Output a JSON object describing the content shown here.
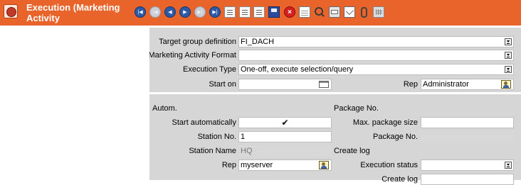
{
  "header": {
    "title": "Execution (Marketing Activity",
    "app_icon": "marketing-activity-icon",
    "color": "#e8642a"
  },
  "toolbar": {
    "buttons": [
      {
        "name": "first-record-button",
        "icon": "first-icon",
        "glyph": "|◀",
        "enabled": true
      },
      {
        "name": "first-disabled-button",
        "icon": "first-icon",
        "glyph": "|◀",
        "enabled": false
      },
      {
        "name": "previous-record-button",
        "icon": "previous-icon",
        "glyph": "◀",
        "enabled": true
      },
      {
        "name": "next-record-button",
        "icon": "next-icon",
        "glyph": "▶",
        "enabled": true
      },
      {
        "name": "last-disabled-button",
        "icon": "last-icon",
        "glyph": "▶|",
        "enabled": false
      },
      {
        "name": "last-record-button",
        "icon": "last-icon",
        "glyph": "▶|",
        "enabled": true
      },
      {
        "name": "new-document-button",
        "icon": "new-document-icon"
      },
      {
        "name": "edit-document-button",
        "icon": "edit-document-icon"
      },
      {
        "name": "copy-document-button",
        "icon": "copy-document-icon"
      },
      {
        "name": "save-button",
        "icon": "save-icon"
      },
      {
        "name": "delete-button",
        "icon": "delete-icon"
      },
      {
        "name": "list-view-button",
        "icon": "list-icon"
      },
      {
        "name": "search-button",
        "icon": "search-icon"
      },
      {
        "name": "print-button",
        "icon": "print-icon"
      },
      {
        "name": "email-button",
        "icon": "email-icon"
      },
      {
        "name": "attachment-button",
        "icon": "paperclip-icon"
      },
      {
        "name": "grid-view-button",
        "icon": "grid-icon"
      }
    ]
  },
  "general": {
    "target_group_label": "Target group definition",
    "target_group_value": "FI_DACH",
    "activity_format_label": "Marketing Activity Format",
    "activity_format_value": "",
    "execution_type_label": "Execution Type",
    "execution_type_value": "One-off, execute selection/query",
    "start_on_label": "Start on",
    "start_on_value": "",
    "rep_label": "Rep",
    "rep_value": "Administrator"
  },
  "autom": {
    "section_label": "Autom.",
    "start_auto_label": "Start automatically",
    "start_auto_value": "✔",
    "station_no_label": "Station No.",
    "station_no_value": "1",
    "station_name_label": "Station Name",
    "station_name_value": "HQ",
    "rep_label": "Rep",
    "rep_value": "myserver"
  },
  "package": {
    "section_label": "Package No.",
    "max_size_label": "Max. package size",
    "max_size_value": "",
    "package_no_label": "Package No.",
    "package_no_value": ""
  },
  "create_log": {
    "section_label": "Create log",
    "execution_status_label": "Execution status",
    "execution_status_value": "",
    "create_log_label": "Create log"
  }
}
